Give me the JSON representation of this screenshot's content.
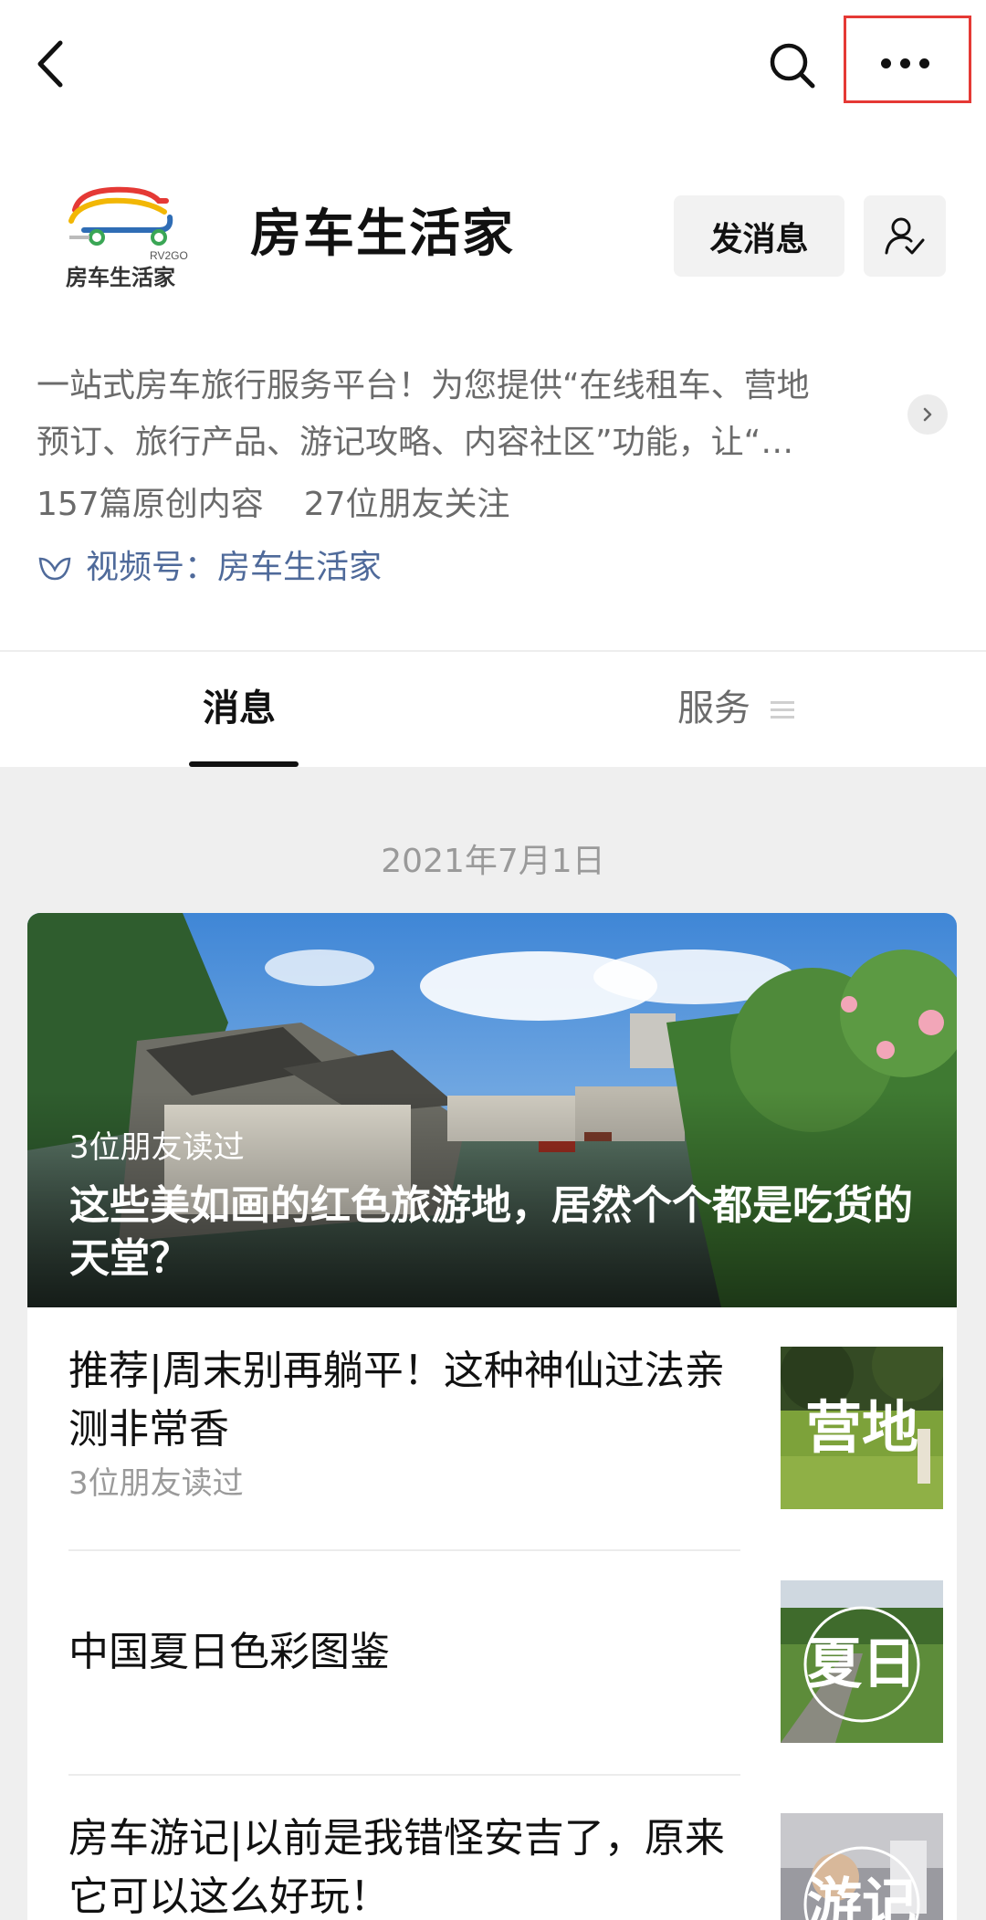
{
  "account": {
    "name": "房车生活家",
    "logo_text": "房车生活家",
    "logo_sub": "RV2GO",
    "message_button": "发消息",
    "description_line1": "一站式房车旅行服务平台！为您提供“在线租车、营地",
    "description_line2": "预订、旅行产品、游记攻略、内容社区”功能，让“…",
    "stats_original": "157篇原创内容",
    "stats_followers": "27位朋友关注",
    "channel": "视频号：房车生活家"
  },
  "tabs": {
    "messages": "消息",
    "services": "服务"
  },
  "feed": {
    "date": "2021年7月1日",
    "cover": {
      "read": "3位朋友读过",
      "title": "这些美如画的红色旅游地，居然个个都是吃货的天堂？"
    },
    "items": [
      {
        "title": "推荐|周末别再躺平！这种神仙过法亲测非常香",
        "read": "3位朋友读过",
        "thumb_text": "营地"
      },
      {
        "title": "中国夏日色彩图鉴",
        "read": "",
        "thumb_text": "夏日"
      },
      {
        "title": "房车游记|以前是我错怪安吉了，原来它可以这么好玩！",
        "read": "",
        "thumb_text": "游记"
      }
    ]
  },
  "colors": {
    "highlight_border": "#e53935",
    "link_blue": "#4f6a9a",
    "feed_bg": "#efefef"
  }
}
